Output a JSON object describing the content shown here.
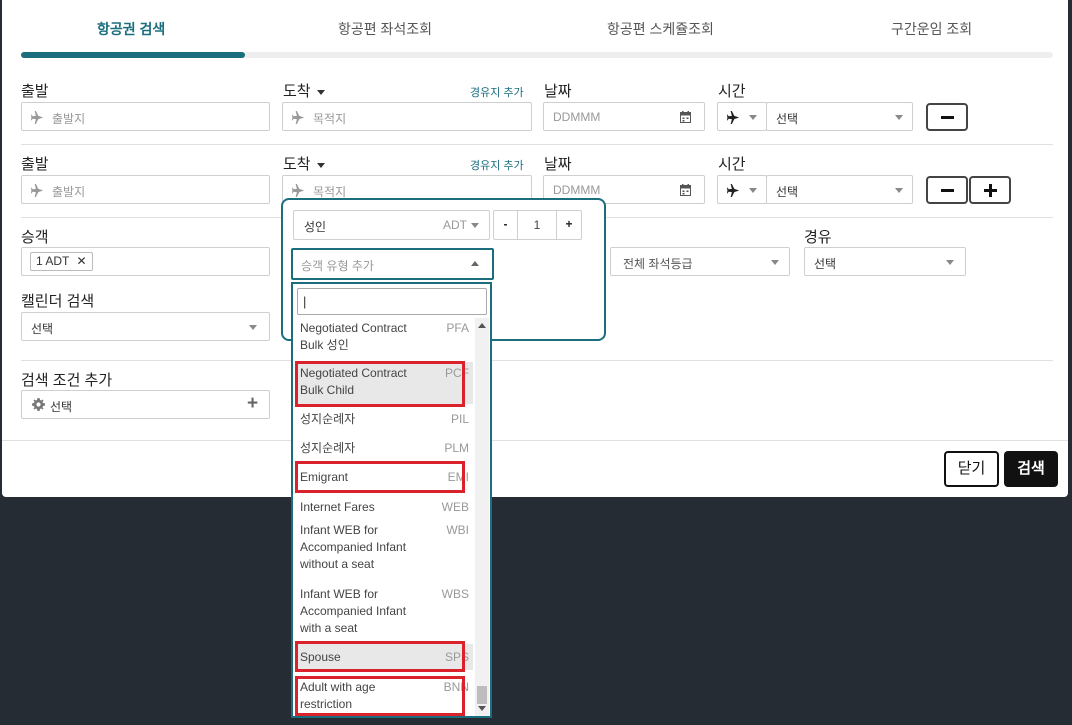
{
  "tabs": [
    {
      "label": "항공권 검색"
    },
    {
      "label": "항공편 좌석조회"
    },
    {
      "label": "항공편 스케쥴조회"
    },
    {
      "label": "구간운임 조회"
    }
  ],
  "rows": [
    {
      "origin_label": "출발",
      "origin_placeholder": "출발지",
      "dest_label": "도착",
      "dest_placeholder": "목적지",
      "via_link": "경유지 추가",
      "date_label": "날짜",
      "date_placeholder": "DDMMM",
      "time_label": "시간",
      "time_value": "선택"
    },
    {
      "origin_label": "출발",
      "origin_placeholder": "출발지",
      "dest_label": "도착",
      "dest_placeholder": "목적지",
      "via_link": "경유지 추가",
      "date_label": "날짜",
      "date_placeholder": "DDMMM",
      "time_label": "시간",
      "time_value": "선택"
    }
  ],
  "passenger": {
    "label": "승객",
    "tag": "1 ADT",
    "tag_close": "✕"
  },
  "calendar": {
    "label": "캘린더 검색",
    "value": "선택"
  },
  "cabin": {
    "value": "전체 좌석등급"
  },
  "transit": {
    "label": "경유",
    "value": "선택"
  },
  "search_condition": {
    "label": "검색 조건 추가",
    "value": "선택",
    "add": "+"
  },
  "popup": {
    "pax_type": "성인",
    "pax_code": "ADT",
    "minus": "-",
    "count": "1",
    "plus": "+",
    "add_type_placeholder": "승객 유형 추가",
    "search_value": "|"
  },
  "options": [
    {
      "name": "Negotiated Contract Bulk 성인",
      "code": "PFA"
    },
    {
      "name": "Negotiated Contract Bulk Child",
      "code": "PCF"
    },
    {
      "name": "성지순례자",
      "code": "PIL"
    },
    {
      "name": "성지순례자",
      "code": "PLM"
    },
    {
      "name": "Emigrant",
      "code": "EMI"
    },
    {
      "name": "Internet Fares",
      "code": "WEB"
    },
    {
      "name": "Infant WEB for Accompanied Infant without a seat",
      "code": "WBI"
    },
    {
      "name": "Infant WEB for Accompanied Infant with a seat",
      "code": "WBS"
    },
    {
      "name": "Spouse",
      "code": "SPS"
    },
    {
      "name": "Adult with age restriction",
      "code": "BNN"
    }
  ],
  "footer": {
    "close": "닫기",
    "search": "검색"
  },
  "colors": {
    "accent": "#1a6e7e",
    "highlight": "#d9222c",
    "dark_bg": "#252c33"
  }
}
